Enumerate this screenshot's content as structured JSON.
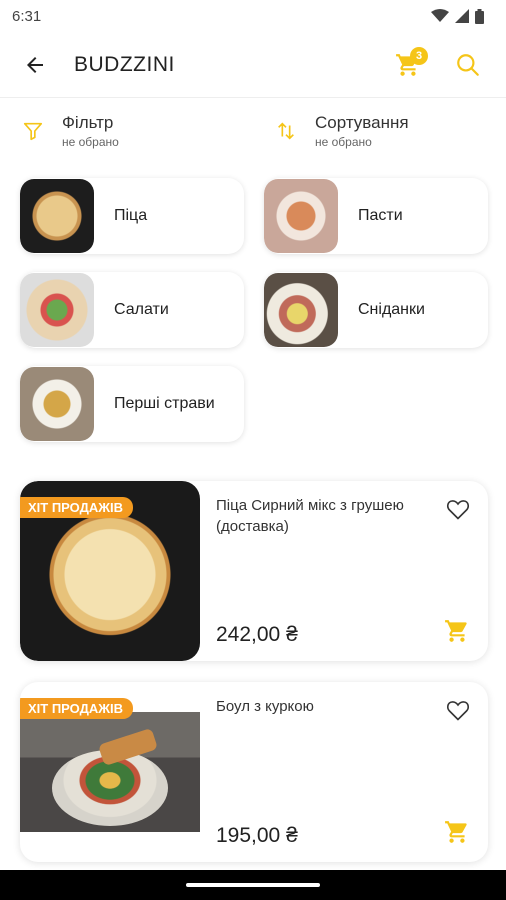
{
  "status_bar": {
    "time": "6:31"
  },
  "app_bar": {
    "title": "BUDZZINI",
    "cart_count": "3"
  },
  "filters": [
    {
      "title": "Фільтр",
      "subtitle": "не обрано",
      "icon": "filter-icon"
    },
    {
      "title": "Сортування",
      "subtitle": "не обрано",
      "icon": "sort-icon"
    }
  ],
  "categories": [
    {
      "label": "Піца"
    },
    {
      "label": "Пасти"
    },
    {
      "label": "Салати"
    },
    {
      "label": "Сніданки"
    },
    {
      "label": "Перші страви"
    }
  ],
  "products": [
    {
      "badge": "ХІТ ПРОДАЖІВ",
      "name": "Піца Сирний мікс з грушею (доставка)",
      "price": "242,00 ₴"
    },
    {
      "badge": "ХІТ ПРОДАЖІВ",
      "name": "Боул з куркою",
      "price": "195,00 ₴"
    }
  ],
  "colors": {
    "accent": "#f5c518",
    "badge": "#f39a1f"
  }
}
